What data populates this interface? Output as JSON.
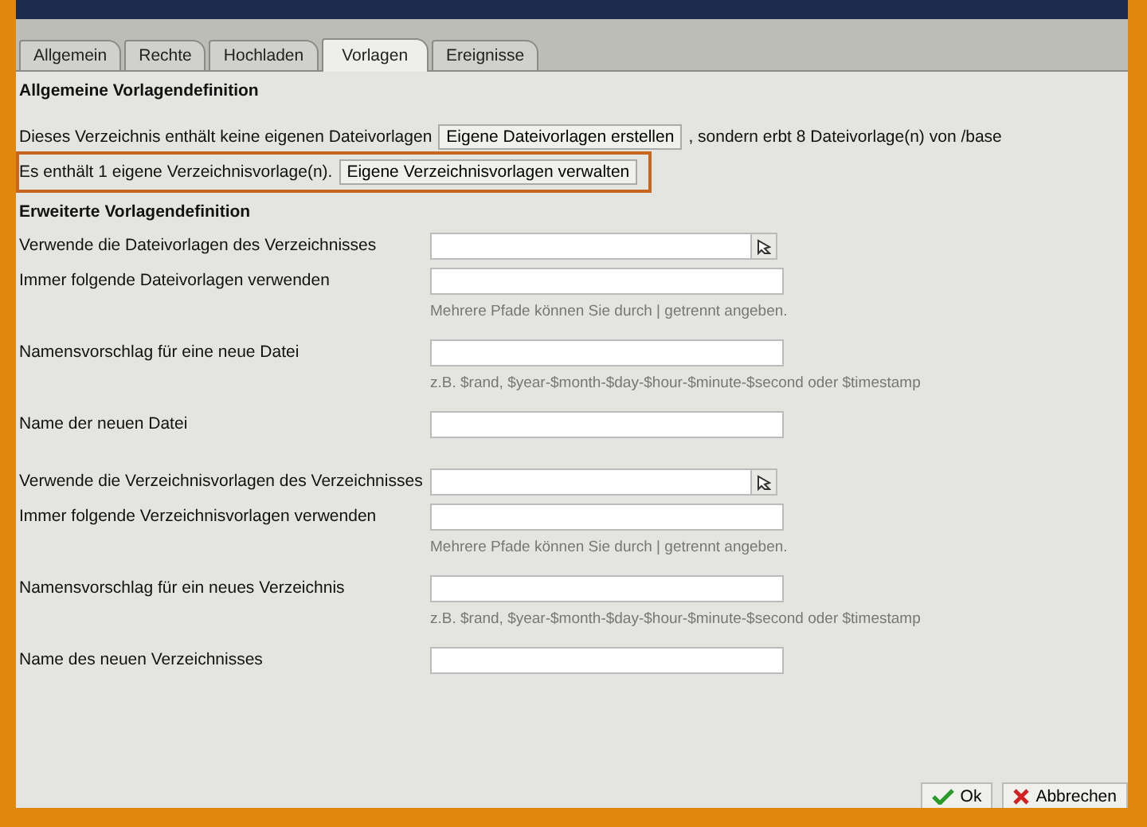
{
  "tabs": [
    {
      "label": "Allgemein",
      "selected": false
    },
    {
      "label": "Rechte",
      "selected": false
    },
    {
      "label": "Hochladen",
      "selected": false
    },
    {
      "label": "Vorlagen",
      "selected": true
    },
    {
      "label": "Ereignisse",
      "selected": false
    }
  ],
  "general": {
    "heading": "Allgemeine Vorlagendefinition",
    "lines": [
      {
        "before": "Dieses Verzeichnis enthält keine eigenen Dateivorlagen",
        "button": "Eigene Dateivorlagen erstellen",
        "after": ", sondern erbt 8 Dateivorlage(n) von /base",
        "highlighted": false
      },
      {
        "before": "Es enthält 1 eigene Verzeichnisvorlage(n).",
        "button": "Eigene Verzeichnisvorlagen verwalten",
        "highlighted": true
      }
    ]
  },
  "advanced": {
    "heading": "Erweiterte Vorlagendefinition",
    "groups": [
      {
        "fields": [
          {
            "kind": "lookup",
            "label": "Verwende die Dateivorlagen des Verzeichnisses"
          },
          {
            "kind": "text",
            "label": "Immer folgende Dateivorlagen verwenden",
            "hint": "Mehrere Pfade können Sie durch | getrennt angeben."
          },
          {
            "kind": "text",
            "label": "Namensvorschlag für eine neue Datei",
            "hint": "z.B. $rand, $year-$month-$day-$hour-$minute-$second oder $timestamp"
          },
          {
            "kind": "text",
            "label": "Name der neuen Datei"
          }
        ]
      },
      {
        "fields": [
          {
            "kind": "lookup",
            "label": "Verwende die Verzeichnisvorlagen des Verzeichnisses"
          },
          {
            "kind": "text",
            "label": "Immer folgende Verzeichnisvorlagen verwenden",
            "hint": "Mehrere Pfade können Sie durch | getrennt angeben."
          },
          {
            "kind": "text",
            "label": "Namensvorschlag für ein neues Verzeichnis",
            "hint": "z.B. $rand, $year-$month-$day-$hour-$minute-$second oder $timestamp"
          },
          {
            "kind": "text",
            "label": "Name des neuen Verzeichnisses"
          }
        ]
      }
    ]
  },
  "footer": {
    "buttons": [
      {
        "kind": "ok",
        "label": "Ok"
      },
      {
        "kind": "cancel",
        "label": "Abbrechen"
      }
    ]
  }
}
